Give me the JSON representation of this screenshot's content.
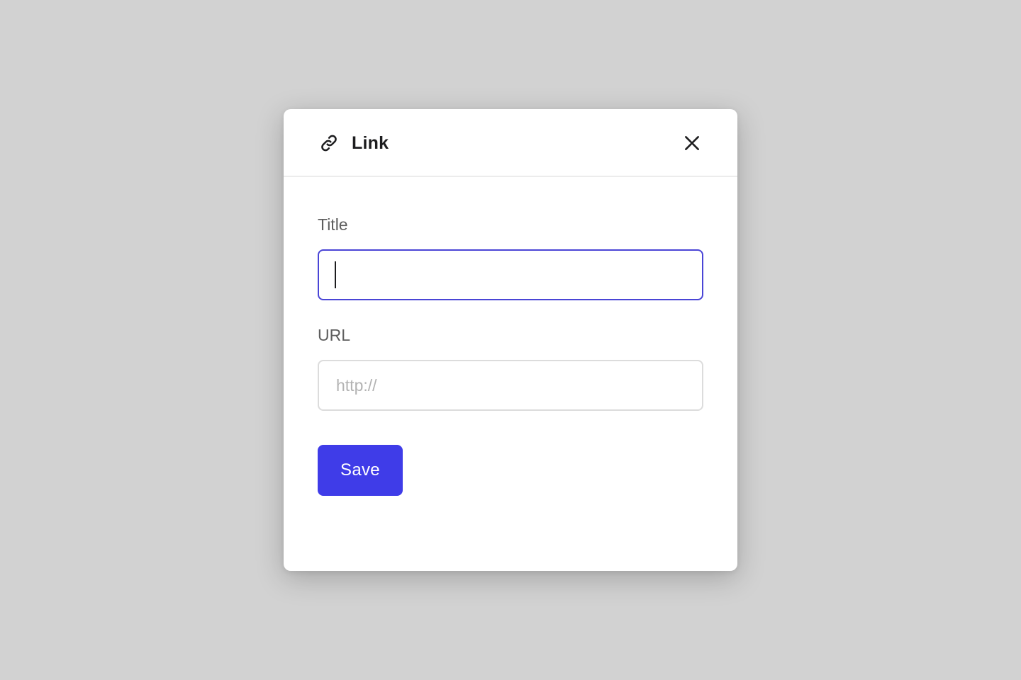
{
  "dialog": {
    "title": "Link",
    "header_icon": "link-icon",
    "close_icon": "close-icon"
  },
  "form": {
    "title_field": {
      "label": "Title",
      "value": "",
      "placeholder": ""
    },
    "url_field": {
      "label": "URL",
      "value": "",
      "placeholder": "http://"
    },
    "save_label": "Save"
  },
  "colors": {
    "backdrop": "#d2d2d2",
    "accent": "#3f3ce8",
    "focus_border": "#4a45d6",
    "input_border": "#dcdcdc",
    "label_text": "#5e5e5e",
    "placeholder_text": "#b3b3b3"
  }
}
